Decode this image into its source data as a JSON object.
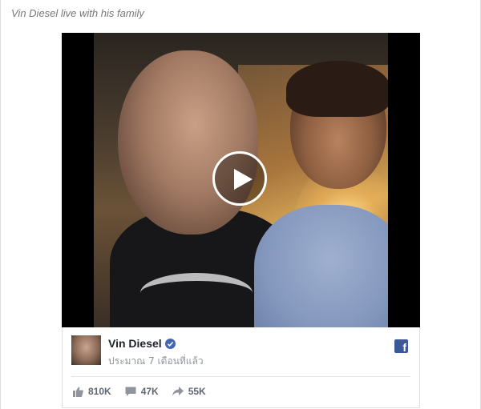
{
  "caption": "Vin Diesel live with his family",
  "video": {
    "play_icon": "play-icon"
  },
  "post": {
    "page_name": "Vin Diesel",
    "verified_icon": "verified-badge-icon",
    "timestamp": "ประมาณ 7 เดือนที่แล้ว",
    "brand_icon": "facebook-icon",
    "brand_color": "#3b5998",
    "stats": {
      "likes": "810K",
      "comments": "47K",
      "shares": "55K"
    }
  }
}
